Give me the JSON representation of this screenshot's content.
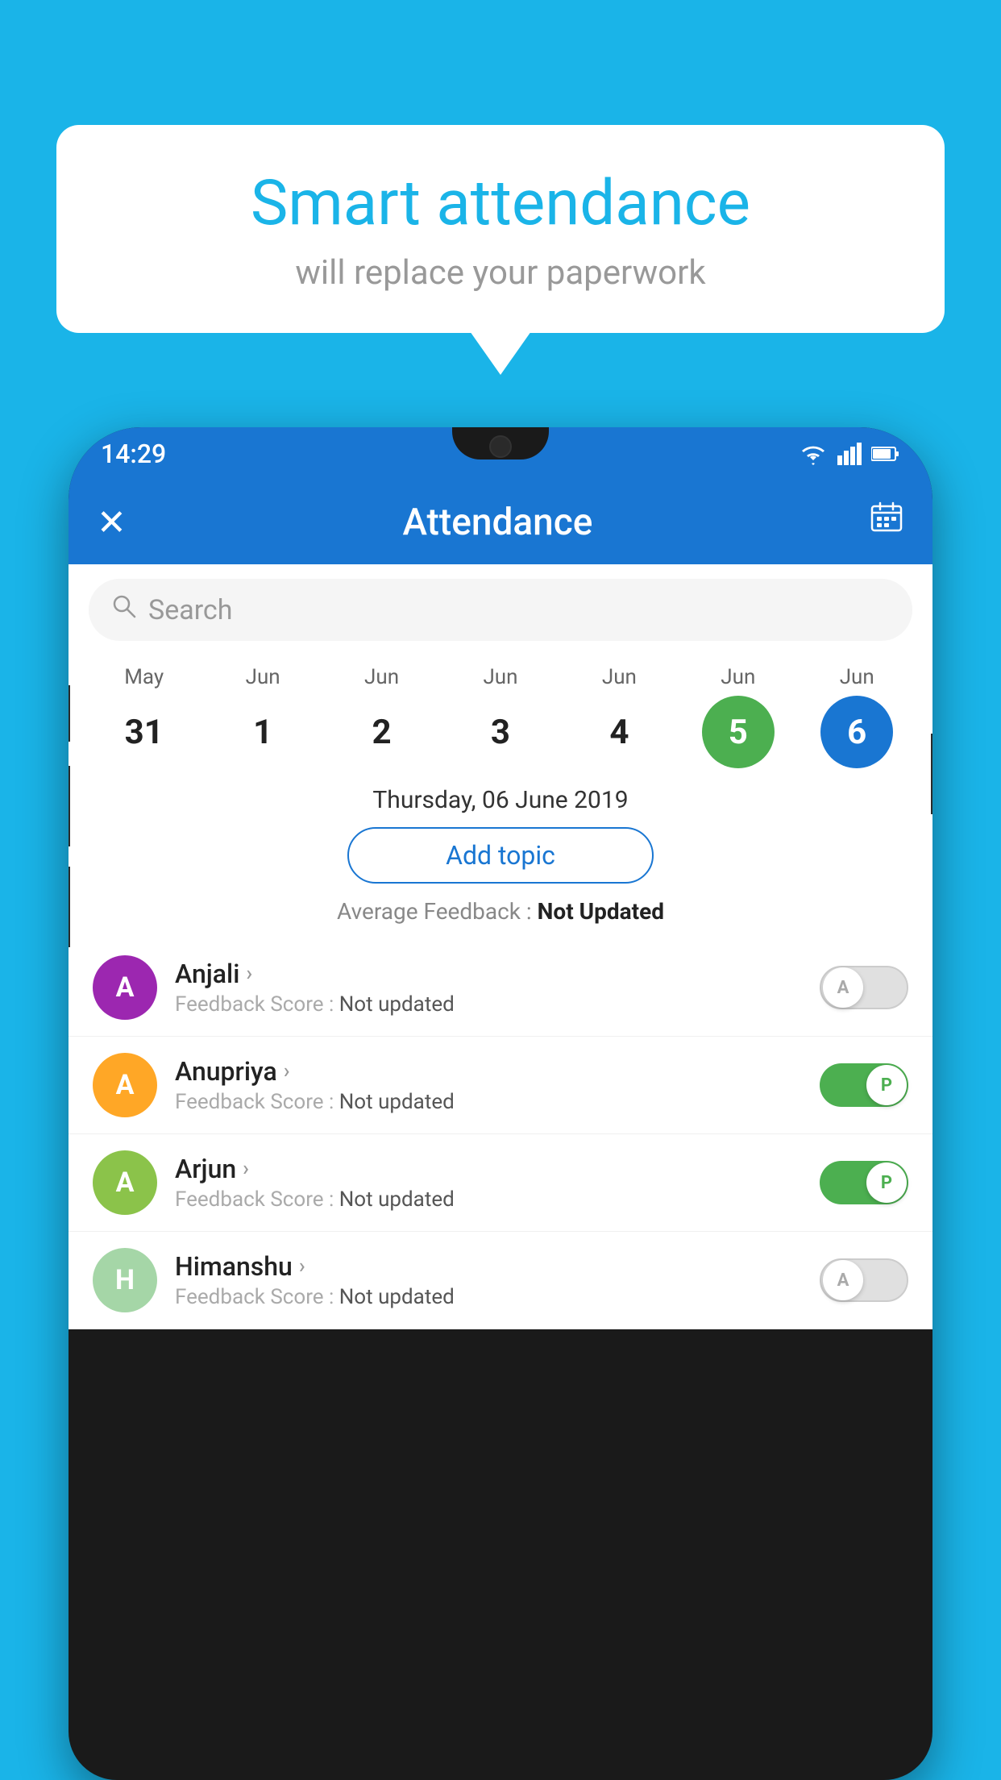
{
  "bubble": {
    "title": "Smart attendance",
    "subtitle": "will replace your paperwork"
  },
  "status_bar": {
    "time": "14:29",
    "wifi": "wifi-icon",
    "signal": "signal-icon",
    "battery": "battery-icon"
  },
  "app_bar": {
    "title": "Attendance",
    "close_label": "✕",
    "calendar_label": "📅"
  },
  "search": {
    "placeholder": "Search"
  },
  "calendar": {
    "dates": [
      {
        "month": "May",
        "day": "31",
        "state": "normal"
      },
      {
        "month": "Jun",
        "day": "1",
        "state": "normal"
      },
      {
        "month": "Jun",
        "day": "2",
        "state": "normal"
      },
      {
        "month": "Jun",
        "day": "3",
        "state": "normal"
      },
      {
        "month": "Jun",
        "day": "4",
        "state": "normal"
      },
      {
        "month": "Jun",
        "day": "5",
        "state": "today"
      },
      {
        "month": "Jun",
        "day": "6",
        "state": "selected"
      }
    ]
  },
  "selected_date": "Thursday, 06 June 2019",
  "add_topic_label": "Add topic",
  "average_feedback": {
    "label": "Average Feedback :",
    "value": "Not Updated"
  },
  "students": [
    {
      "name": "Anjali",
      "avatar_letter": "A",
      "avatar_color": "#9c27b0",
      "feedback_label": "Feedback Score :",
      "feedback_value": "Not updated",
      "toggle_state": "off",
      "toggle_letter": "A"
    },
    {
      "name": "Anupriya",
      "avatar_letter": "A",
      "avatar_color": "#ffa726",
      "feedback_label": "Feedback Score :",
      "feedback_value": "Not updated",
      "toggle_state": "on",
      "toggle_letter": "P"
    },
    {
      "name": "Arjun",
      "avatar_letter": "A",
      "avatar_color": "#8bc34a",
      "feedback_label": "Feedback Score :",
      "feedback_value": "Not updated",
      "toggle_state": "on",
      "toggle_letter": "P"
    },
    {
      "name": "Himanshu",
      "avatar_letter": "H",
      "avatar_color": "#a5d6a7",
      "feedback_label": "Feedback Score :",
      "feedback_value": "Not updated",
      "toggle_state": "off",
      "toggle_letter": "A"
    }
  ]
}
